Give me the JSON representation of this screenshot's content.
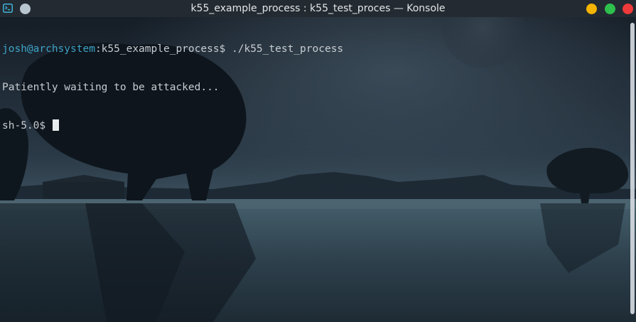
{
  "window": {
    "title": "k55_example_process : k55_test_proces — Konsole"
  },
  "terminal": {
    "prompt1_user_host": "josh@archsystem",
    "prompt1_rest": ":k55_example_process$ ",
    "command1": "./k55_test_process",
    "output1": "Patiently waiting to be attacked...",
    "prompt2": "sh-5.0$ "
  },
  "colors": {
    "titlebar": "#232a31",
    "minimize": "#f4b400",
    "maximize": "#2ebf4d",
    "close": "#ee3a3a",
    "prompt_user_host": "#3da3c7",
    "terminal_text": "#c7ccd1"
  },
  "icons": {
    "app": "konsole-terminal-icon",
    "pin": "pin-icon"
  }
}
